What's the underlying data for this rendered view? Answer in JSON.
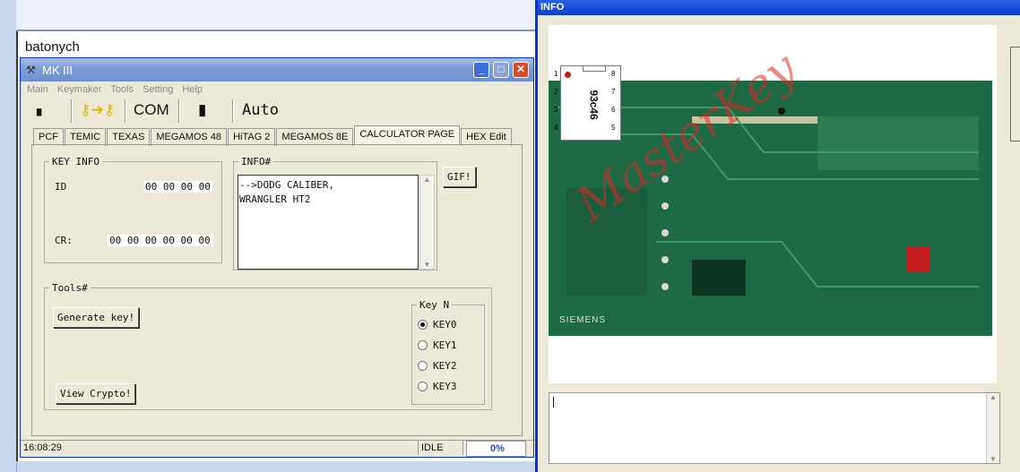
{
  "background_window": {
    "user_label": "batonych"
  },
  "mk_window": {
    "title": "MK III",
    "menu": [
      "Main",
      "Keymaker",
      "Tools",
      "Setting",
      "Help"
    ],
    "toolbar": {
      "com_label": "COM",
      "auto_label": "Auto"
    },
    "tabs": [
      "PCF",
      "TEMIC",
      "TEXAS",
      "MEGAMOS 48",
      "HiTAG 2",
      "MEGAMOS 8E",
      "CALCULATOR PAGE",
      "HEX Edit"
    ],
    "active_tab": "CALCULATOR PAGE",
    "key_info": {
      "legend": "KEY INFO",
      "id_label": "ID",
      "id_value": "00 00 00 00",
      "cr_label": "CR:",
      "cr_value": "00 00 00 00 00 00"
    },
    "info": {
      "legend": "INFO#",
      "line1": "-->DODG CALIBER,",
      "line2": "WRANGLER HT2"
    },
    "gif_button": "GIF!",
    "tools": {
      "legend": "Tools#",
      "generate_button": "Generate key!",
      "view_crypto_button": "View Crypto!"
    },
    "key_n": {
      "legend": "Key N",
      "options": [
        "KEY0",
        "KEY1",
        "KEY2",
        "KEY3"
      ],
      "selected": "KEY0"
    },
    "status": {
      "time": "16:08:29",
      "state": "IDLE",
      "progress": "0%"
    }
  },
  "info_window": {
    "title": "INFO",
    "chip_label": "93c46",
    "chip_pins_left": [
      "1",
      "2",
      "3",
      "4"
    ],
    "chip_pins_right": [
      "8",
      "7",
      "6",
      "5"
    ],
    "board_text": "SIEMENS",
    "watermark": "MasterKey"
  }
}
